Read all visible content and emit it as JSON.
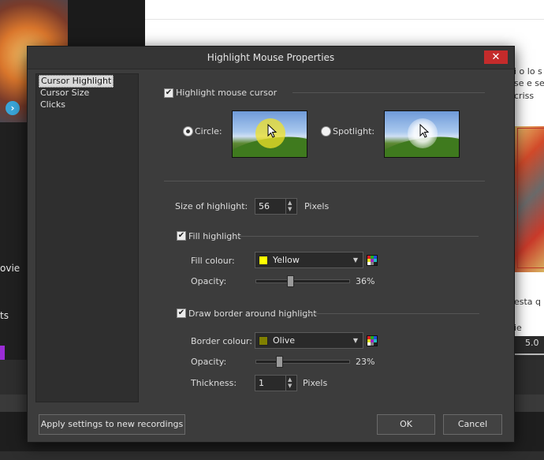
{
  "background": {
    "left_texts": [
      "ovie",
      "ts"
    ],
    "right_texts": [
      "i o lo s",
      "se e se",
      "criss"
    ],
    "right_texts_lower": [
      "esta q u",
      "ie"
    ],
    "timeline_value": "5.0"
  },
  "dialog": {
    "title": "Highlight Mouse Properties",
    "close_label": "✕",
    "nav": [
      "Cursor Highlight",
      "Cursor Size",
      "Clicks"
    ],
    "highlight_cursor_label": "Highlight mouse cursor",
    "circle_label": "Circle:",
    "spotlight_label": "Spotlight:",
    "size_label": "Size of highlight:",
    "size_value": "56",
    "size_unit": "Pixels",
    "fill": {
      "label": "Fill highlight",
      "colour_label": "Fill colour:",
      "colour_name": "Yellow",
      "colour_hex": "#ffff00",
      "opacity_label": "Opacity:",
      "opacity_text": "36%",
      "opacity_value": 0.36
    },
    "border": {
      "label": "Draw border around highlight",
      "colour_label": "Border colour:",
      "colour_name": "Olive",
      "colour_hex": "#808000",
      "opacity_label": "Opacity:",
      "opacity_text": "23%",
      "opacity_value": 0.23,
      "thickness_label": "Thickness:",
      "thickness_value": "1",
      "thickness_unit": "Pixels"
    },
    "buttons": {
      "apply": "Apply settings to new recordings",
      "ok": "OK",
      "cancel": "Cancel"
    }
  }
}
